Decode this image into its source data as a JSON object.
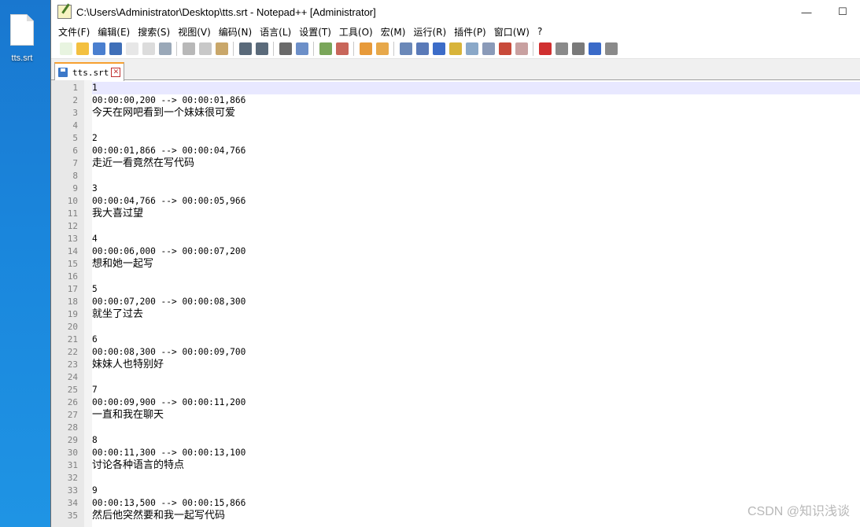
{
  "desktop": {
    "file_label": "tts.srt"
  },
  "window": {
    "title": "C:\\Users\\Administrator\\Desktop\\tts.srt - Notepad++ [Administrator]",
    "minimize": "—",
    "maximize": "☐"
  },
  "menu": [
    "文件(F)",
    "编辑(E)",
    "搜索(S)",
    "视图(V)",
    "编码(N)",
    "语言(L)",
    "设置(T)",
    "工具(O)",
    "宏(M)",
    "运行(R)",
    "插件(P)",
    "窗口(W)",
    "?"
  ],
  "toolbar_icons": [
    "new-file-icon",
    "open-file-icon",
    "save-icon",
    "save-all-icon",
    "close-icon",
    "close-all-icon",
    "print-icon",
    "|",
    "cut-icon",
    "copy-icon",
    "paste-icon",
    "|",
    "undo-icon",
    "redo-icon",
    "|",
    "find-icon",
    "replace-icon",
    "|",
    "zoom-in-icon",
    "zoom-out-icon",
    "|",
    "sync-vertical-icon",
    "sync-horizontal-icon",
    "|",
    "word-wrap-icon",
    "show-all-chars-icon",
    "indent-guide-icon",
    "user-lang-icon",
    "doc-map-icon",
    "function-list-icon",
    "folder-workspace-icon",
    "monitor-icon",
    "|",
    "record-macro-icon",
    "stop-macro-icon",
    "play-macro-icon",
    "run-macro-multiple-icon",
    "save-macro-icon"
  ],
  "tab": {
    "label": "tts.srt",
    "close": "✕"
  },
  "editor": {
    "lines": [
      {
        "n": "1",
        "text": "1"
      },
      {
        "n": "2",
        "text": "00:00:00,200 --> 00:00:01,866"
      },
      {
        "n": "3",
        "text": "今天在网吧看到一个妹妹很可爱",
        "zh": true
      },
      {
        "n": "4",
        "text": ""
      },
      {
        "n": "5",
        "text": "2"
      },
      {
        "n": "6",
        "text": "00:00:01,866 --> 00:00:04,766"
      },
      {
        "n": "7",
        "text": "走近一看竟然在写代码",
        "zh": true
      },
      {
        "n": "8",
        "text": ""
      },
      {
        "n": "9",
        "text": "3"
      },
      {
        "n": "10",
        "text": "00:00:04,766 --> 00:00:05,966"
      },
      {
        "n": "11",
        "text": "我大喜过望",
        "zh": true
      },
      {
        "n": "12",
        "text": ""
      },
      {
        "n": "13",
        "text": "4"
      },
      {
        "n": "14",
        "text": "00:00:06,000 --> 00:00:07,200"
      },
      {
        "n": "15",
        "text": "想和她一起写",
        "zh": true
      },
      {
        "n": "16",
        "text": ""
      },
      {
        "n": "17",
        "text": "5"
      },
      {
        "n": "18",
        "text": "00:00:07,200 --> 00:00:08,300"
      },
      {
        "n": "19",
        "text": "就坐了过去",
        "zh": true
      },
      {
        "n": "20",
        "text": ""
      },
      {
        "n": "21",
        "text": "6"
      },
      {
        "n": "22",
        "text": "00:00:08,300 --> 00:00:09,700"
      },
      {
        "n": "23",
        "text": "妹妹人也特别好",
        "zh": true
      },
      {
        "n": "24",
        "text": ""
      },
      {
        "n": "25",
        "text": "7"
      },
      {
        "n": "26",
        "text": "00:00:09,900 --> 00:00:11,200"
      },
      {
        "n": "27",
        "text": "一直和我在聊天",
        "zh": true
      },
      {
        "n": "28",
        "text": ""
      },
      {
        "n": "29",
        "text": "8"
      },
      {
        "n": "30",
        "text": "00:00:11,300 --> 00:00:13,100"
      },
      {
        "n": "31",
        "text": "讨论各种语言的特点",
        "zh": true
      },
      {
        "n": "32",
        "text": ""
      },
      {
        "n": "33",
        "text": "9"
      },
      {
        "n": "34",
        "text": "00:00:13,500 --> 00:00:15,866"
      },
      {
        "n": "35",
        "text": "然后他突然要和我一起写代码",
        "zh": true
      }
    ]
  },
  "watermark": "CSDN @知识浅谈"
}
